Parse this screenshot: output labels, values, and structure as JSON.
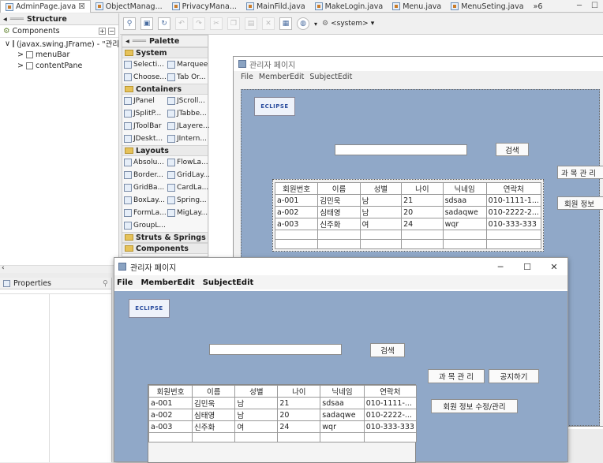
{
  "tabs": [
    {
      "label": "AdminPage.java",
      "active": true,
      "close": "☒"
    },
    {
      "label": "ObjectManag..."
    },
    {
      "label": "PrivacyMana..."
    },
    {
      "label": "MainFild.java"
    },
    {
      "label": "MakeLogin.java"
    },
    {
      "label": "Menu.java"
    },
    {
      "label": "MenuSeting.java"
    },
    {
      "label": "»6"
    }
  ],
  "window_controls": {
    "minimize": "─",
    "maximize": "☐"
  },
  "structure": {
    "title": "Structure",
    "components_label": "Components",
    "tree": [
      {
        "label": "(javax.swing.JFrame) - \"관리",
        "indent": 0,
        "expander": "∨"
      },
      {
        "label": "menuBar",
        "indent": 1,
        "expander": ">"
      },
      {
        "label": "contentPane",
        "indent": 1,
        "expander": ">"
      }
    ]
  },
  "properties": {
    "title": "Properties"
  },
  "toolbar": {
    "system_label": "<system>"
  },
  "palette": {
    "title": "Palette",
    "categories": [
      {
        "name": "System",
        "items": [
          "Selecti...",
          "Marquee",
          "Choose...",
          "Tab Or..."
        ]
      },
      {
        "name": "Containers",
        "items": [
          "JPanel",
          "JScroll...",
          "JSplitP...",
          "JTabbe...",
          "JToolBar",
          "JLayere...",
          "JDeskt...",
          "JIntern..."
        ]
      },
      {
        "name": "Layouts",
        "items": [
          "Absolu...",
          "FlowLa...",
          "Border...",
          "GridLay...",
          "GridBa...",
          "CardLa...",
          "BoxLay...",
          "Spring...",
          "FormLa...",
          "MigLay...",
          "GroupL..."
        ]
      },
      {
        "name": "Struts & Springs",
        "items": []
      },
      {
        "name": "Components",
        "items": []
      }
    ]
  },
  "design": {
    "frame_title": "관리자 페이지",
    "menus": [
      "File",
      "MemberEdit",
      "SubjectEdit"
    ],
    "logo_text": "ECLIPSE",
    "search_button": "검색",
    "subject_button": "과 목 관 리",
    "member_button": "회원 정보"
  },
  "runtime": {
    "title": "관리자 페이지",
    "controls": {
      "minimize": "─",
      "maximize": "☐",
      "close": "✕"
    },
    "menus": [
      "File",
      "MemberEdit",
      "SubjectEdit"
    ],
    "logo_text": "ECLIPSE",
    "search_button": "검색",
    "subject_button": "과 목 관 리",
    "notice_button": "공지하기",
    "member_button": "회원 정보 수정/관리"
  },
  "members_table": {
    "columns": [
      "회원번호",
      "이름",
      "성별",
      "나이",
      "닉네임",
      "연락처"
    ],
    "rows": [
      [
        "a-001",
        "김민욱",
        "남",
        "21",
        "sdsaa",
        "010-1111-1..."
      ],
      [
        "a-002",
        "심태영",
        "남",
        "20",
        "sadaqwe",
        "010-2222-2..."
      ],
      [
        "a-003",
        "신주화",
        "여",
        "24",
        "wqr",
        "010-333-333"
      ]
    ],
    "runtime_rows": [
      [
        "a-001",
        "김민욱",
        "남",
        "21",
        "sdsaa",
        "010-1111-..."
      ],
      [
        "a-002",
        "심태영",
        "남",
        "20",
        "sadaqwe",
        "010-2222-..."
      ],
      [
        "a-003",
        "신주화",
        "여",
        "24",
        "wqr",
        "010-333-333"
      ]
    ]
  }
}
